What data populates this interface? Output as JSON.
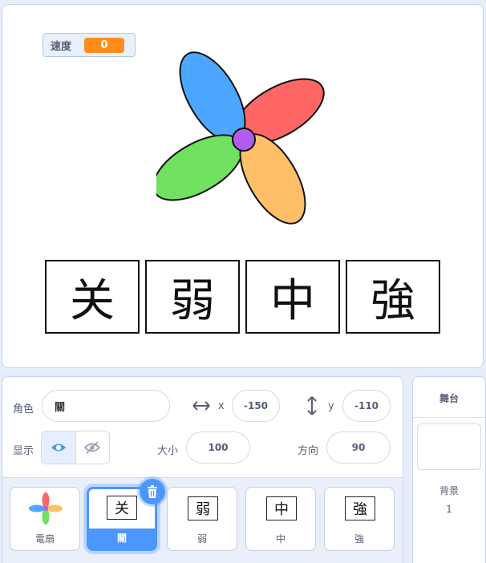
{
  "monitor": {
    "label": "速度",
    "value": "0"
  },
  "stage_words": [
    "关",
    "弱",
    "中",
    "強"
  ],
  "sprite_info": {
    "sprite_label": "角色",
    "sprite_name": "關",
    "x_label": "x",
    "x_value": "-150",
    "y_label": "y",
    "y_value": "-110",
    "show_label": "显示",
    "size_label": "大小",
    "size_value": "100",
    "direction_label": "方向",
    "direction_value": "90"
  },
  "sprites": [
    {
      "name": "電扇",
      "thumb": ""
    },
    {
      "name": "關",
      "thumb": "关"
    },
    {
      "name": "弱",
      "thumb": "弱"
    },
    {
      "name": "中",
      "thumb": "中"
    },
    {
      "name": "強",
      "thumb": "強"
    }
  ],
  "stage_panel": {
    "title": "舞台",
    "backdrops_label": "背景",
    "backdrops_count": "1"
  },
  "colors": {
    "accent": "#4c97ff",
    "monitor_value": "#ff8c1a",
    "blade_blue": "#4da6ff",
    "blade_red": "#ff6666",
    "blade_green": "#70e060",
    "blade_orange": "#ffbf66",
    "hub": "#b05cf0"
  }
}
